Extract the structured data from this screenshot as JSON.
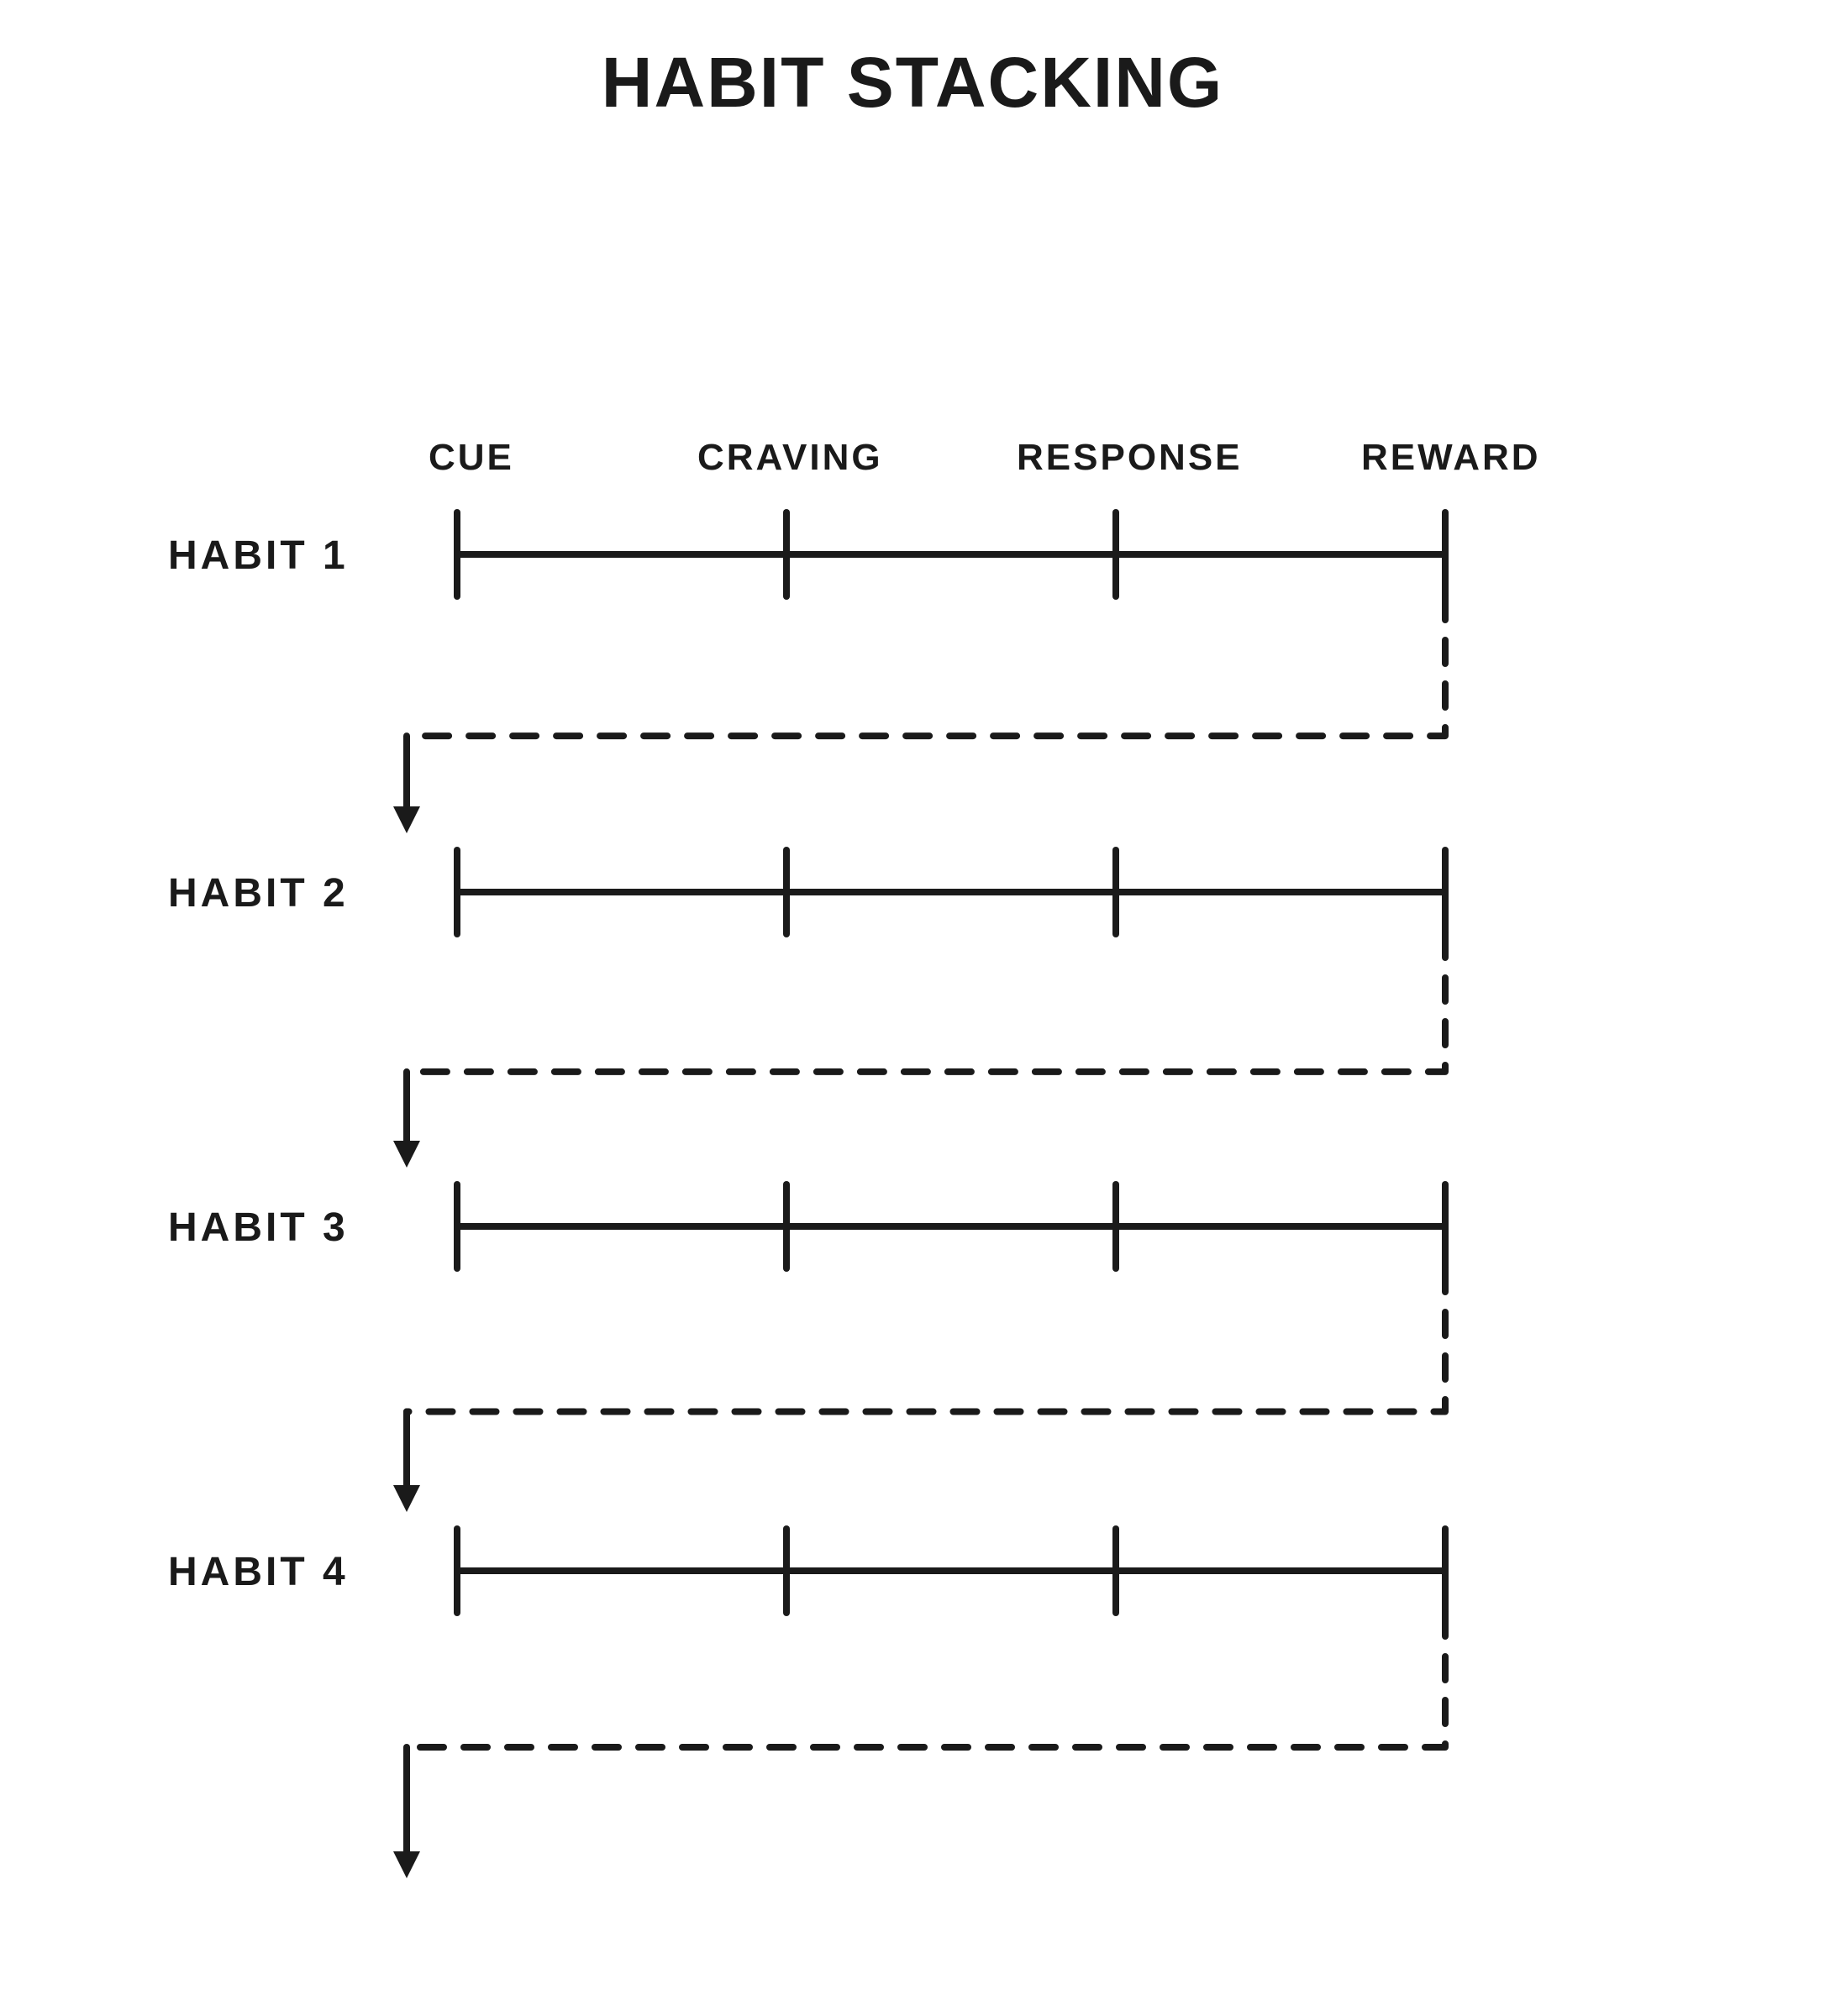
{
  "title": "HABIT STACKING",
  "columns": [
    "CUE",
    "CRAVING",
    "RESPONSE",
    "REWARD"
  ],
  "rows": [
    "HABIT 1",
    "HABIT 2",
    "HABIT 3",
    "HABIT 4"
  ],
  "layout": {
    "col_x": [
      544,
      936,
      1328,
      1720
    ],
    "row_y": [
      660,
      1062,
      1460,
      1870
    ],
    "tick_half": 50,
    "stroke": "#1a1a1a",
    "stroke_width": 8,
    "dash": "28 24",
    "col_label_y": 540,
    "row_label_x": 200,
    "connector_drop": 120,
    "connector_left_extend": 60,
    "arrow_gap": 36
  }
}
